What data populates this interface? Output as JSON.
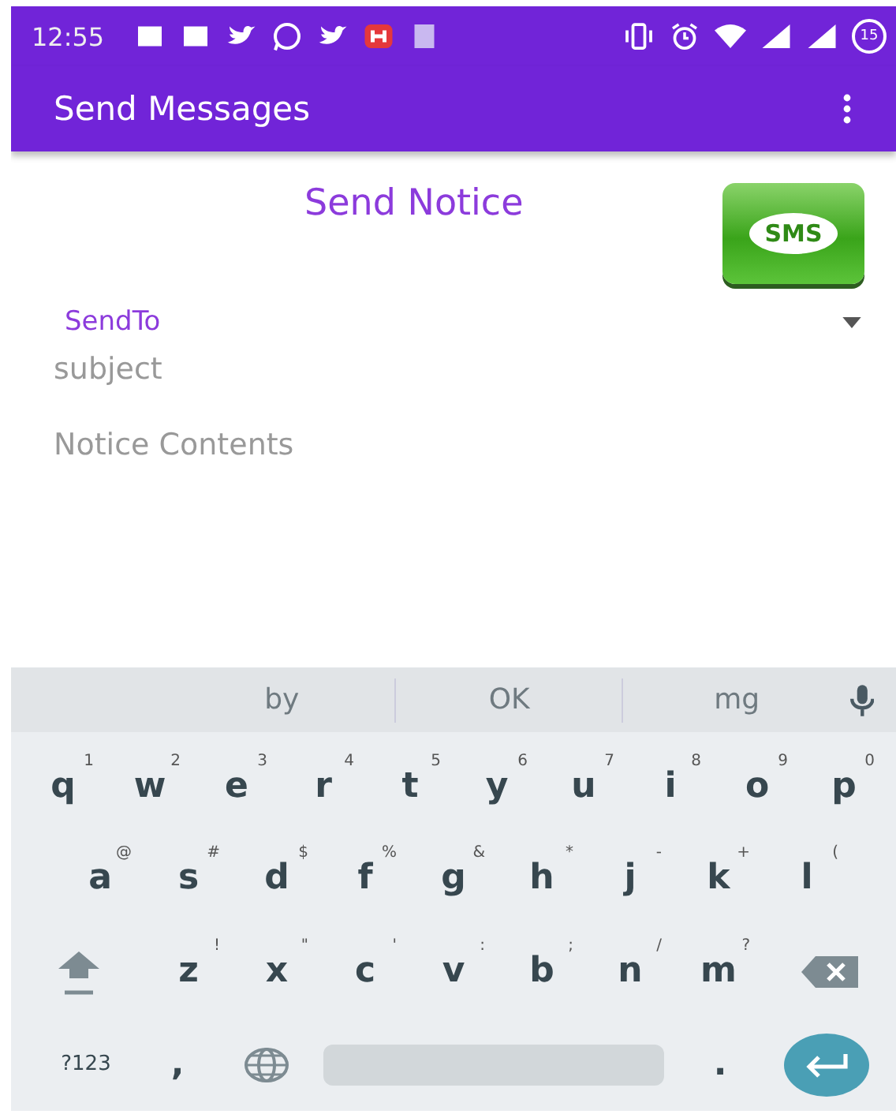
{
  "status_bar": {
    "time": "12:55",
    "battery": "15"
  },
  "app_bar": {
    "title": "Send Messages"
  },
  "heading": "Send Notice",
  "sms_badge": "SMS",
  "form": {
    "send_to": "SendTo",
    "subject": {
      "placeholder": "subject"
    },
    "contents": {
      "placeholder": "Notice Contents"
    }
  },
  "keyboard": {
    "suggestions": [
      "by",
      "OK",
      "mg"
    ],
    "rows": [
      {
        "keys": [
          {
            "kind": "letter",
            "label": "q",
            "hint": "1"
          },
          {
            "kind": "letter",
            "label": "w",
            "hint": "2"
          },
          {
            "kind": "letter",
            "label": "e",
            "hint": "3"
          },
          {
            "kind": "letter",
            "label": "r",
            "hint": "4"
          },
          {
            "kind": "letter",
            "label": "t",
            "hint": "5"
          },
          {
            "kind": "letter",
            "label": "y",
            "hint": "6"
          },
          {
            "kind": "letter",
            "label": "u",
            "hint": "7"
          },
          {
            "kind": "letter",
            "label": "i",
            "hint": "8"
          },
          {
            "kind": "letter",
            "label": "o",
            "hint": "9"
          },
          {
            "kind": "letter",
            "label": "p",
            "hint": "0"
          }
        ]
      },
      {
        "keys": [
          {
            "kind": "letter",
            "label": "a",
            "hint": "@"
          },
          {
            "kind": "letter",
            "label": "s",
            "hint": "#"
          },
          {
            "kind": "letter",
            "label": "d",
            "hint": "$"
          },
          {
            "kind": "letter",
            "label": "f",
            "hint": "%"
          },
          {
            "kind": "letter",
            "label": "g",
            "hint": "&"
          },
          {
            "kind": "letter",
            "label": "h",
            "hint": "*"
          },
          {
            "kind": "letter",
            "label": "j",
            "hint": "-"
          },
          {
            "kind": "letter",
            "label": "k",
            "hint": "+"
          },
          {
            "kind": "letter",
            "label": "l",
            "hint": "("
          }
        ]
      },
      {
        "keys": [
          {
            "kind": "shift"
          },
          {
            "kind": "letter",
            "label": "z",
            "hint": "!"
          },
          {
            "kind": "letter",
            "label": "x",
            "hint": "\""
          },
          {
            "kind": "letter",
            "label": "c",
            "hint": "'"
          },
          {
            "kind": "letter",
            "label": "v",
            "hint": ":"
          },
          {
            "kind": "letter",
            "label": "b",
            "hint": ";"
          },
          {
            "kind": "letter",
            "label": "n",
            "hint": "/"
          },
          {
            "kind": "letter",
            "label": "m",
            "hint": "?"
          },
          {
            "kind": "backspace"
          }
        ]
      },
      {
        "keys": [
          {
            "kind": "symbols",
            "label": "?123"
          },
          {
            "kind": "letter",
            "label": ","
          },
          {
            "kind": "globe"
          },
          {
            "kind": "space"
          },
          {
            "kind": "letter",
            "label": "."
          },
          {
            "kind": "enter"
          }
        ]
      }
    ]
  }
}
